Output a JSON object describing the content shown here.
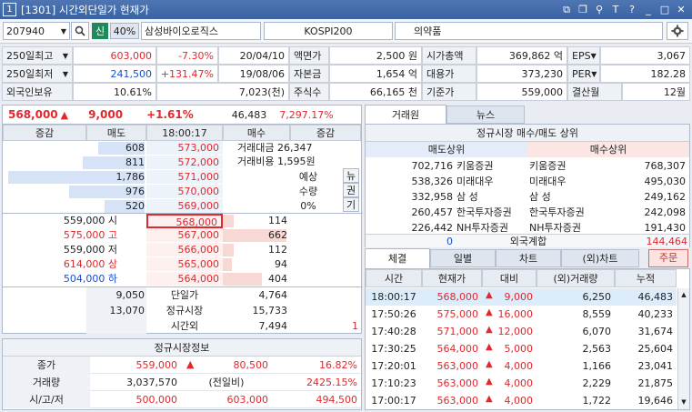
{
  "window": {
    "number": "1",
    "title": "[1301] 시간외단일가 현재가"
  },
  "toolbar": {
    "code": "207940",
    "flag": "신",
    "margin": "40%",
    "name": "삼성바이오로직스",
    "index": "KOSPI200",
    "sector": "의약품"
  },
  "info": {
    "row1": [
      "250일최고",
      "603,000",
      "-7.30%",
      "20/04/10",
      "액면가",
      "2,500 원",
      "시가총액",
      "369,862 억",
      "EPS",
      "3,067"
    ],
    "row2": [
      "250일최저",
      "241,500",
      "+131.47%",
      "19/08/06",
      "자본금",
      "1,654 억",
      "대용가",
      "373,230",
      "PER",
      "182.28"
    ],
    "row3": [
      "외국인보유",
      "10.61%",
      "7,023(천)",
      "주식수",
      "66,165 천",
      "기준가",
      "559,000",
      "결산월",
      "12월"
    ]
  },
  "quote": {
    "price": "568,000",
    "change": "9,000",
    "pct": "+1.61%",
    "volume": "46,483",
    "turnover_pct": "7,297.17%"
  },
  "orderbook": {
    "headers": [
      "증감",
      "매도",
      "18:00:17",
      "매수",
      "증감"
    ],
    "asks": [
      {
        "qty": "608",
        "price": "573,000",
        "fill": 0.34
      },
      {
        "qty": "811",
        "price": "572,000",
        "fill": 0.45
      },
      {
        "qty": "1,786",
        "price": "571,000",
        "fill": 1.0
      },
      {
        "qty": "976",
        "price": "570,000",
        "fill": 0.55
      },
      {
        "qty": "520",
        "price": "569,000",
        "fill": 0.29
      }
    ],
    "info_lines": [
      "거래대금 26,347",
      "거래비용 1,595원"
    ],
    "side_labels": [
      "예상",
      "수량",
      "0%"
    ],
    "side_buttons": [
      "뉴",
      "권",
      "기"
    ],
    "stats": [
      {
        "label": "559,000 시",
        "cls": "",
        "price": "568,000",
        "qty": "114",
        "fill": 0.17
      },
      {
        "label": "575,000 고",
        "cls": "red",
        "price": "567,000",
        "qty": "662",
        "fill": 1.0
      },
      {
        "label": "559,000 저",
        "cls": "",
        "price": "566,000",
        "qty": "112",
        "fill": 0.17
      },
      {
        "label": "614,000 상",
        "cls": "red",
        "price": "565,000",
        "qty": "94",
        "fill": 0.14
      },
      {
        "label": "504,000 하",
        "cls": "blue",
        "price": "564,000",
        "qty": "404",
        "fill": 0.61
      }
    ],
    "totals": [
      {
        "left": "9,050",
        "label": "단일가",
        "right": "4,764",
        "extra": ""
      },
      {
        "left": "13,070",
        "label": "정규시장",
        "right": "15,733",
        "extra": ""
      },
      {
        "left": "",
        "label": "시간외",
        "right": "7,494",
        "extra": "1"
      }
    ]
  },
  "regular": {
    "title": "정규시장정보",
    "rows": [
      [
        "종가",
        "559,000",
        "80,500",
        "16.82%"
      ],
      [
        "거래량",
        "3,037,570",
        "(전일비)",
        "2425.15%"
      ],
      [
        "시/고/저",
        "500,000",
        "603,000",
        "494,500"
      ]
    ]
  },
  "broker": {
    "tabs": [
      "거래원",
      "뉴스"
    ],
    "title": "정규시장 매수/매도 상위",
    "sell_header": "매도상위",
    "buy_header": "매수상위",
    "rows": [
      [
        "702,716",
        "키움증권",
        "키움증권",
        "768,307"
      ],
      [
        "538,326",
        "미래대우",
        "미래대우",
        "495,030"
      ],
      [
        "332,958",
        "삼  성",
        "삼  성",
        "249,162"
      ],
      [
        "260,457",
        "한국투자증권",
        "한국투자증권",
        "242,098"
      ],
      [
        "226,442",
        "NH투자증권",
        "NH투자증권",
        "191,430"
      ]
    ],
    "foreign": [
      "0",
      "외국계합",
      "144,464"
    ]
  },
  "trades": {
    "tabs": [
      "체결",
      "일별",
      "차트",
      "(외)차트"
    ],
    "order_button": "주문",
    "headers": [
      "시간",
      "현재가",
      "대비",
      "(외)거래량",
      "누적"
    ],
    "rows": [
      [
        "18:00:17",
        "568,000",
        "9,000",
        "6,250",
        "46,483"
      ],
      [
        "17:50:26",
        "575,000",
        "16,000",
        "8,559",
        "40,233"
      ],
      [
        "17:40:28",
        "571,000",
        "12,000",
        "6,070",
        "31,674"
      ],
      [
        "17:30:25",
        "564,000",
        "5,000",
        "2,563",
        "25,604"
      ],
      [
        "17:20:01",
        "563,000",
        "4,000",
        "1,166",
        "23,041"
      ],
      [
        "17:10:23",
        "563,000",
        "4,000",
        "2,229",
        "21,875"
      ],
      [
        "17:00:17",
        "563,000",
        "4,000",
        "1,722",
        "19,646"
      ]
    ]
  },
  "icons": [
    "search-icon",
    "gear-icon",
    "triangle-up-icon",
    "dropdown-arrow-icon"
  ]
}
